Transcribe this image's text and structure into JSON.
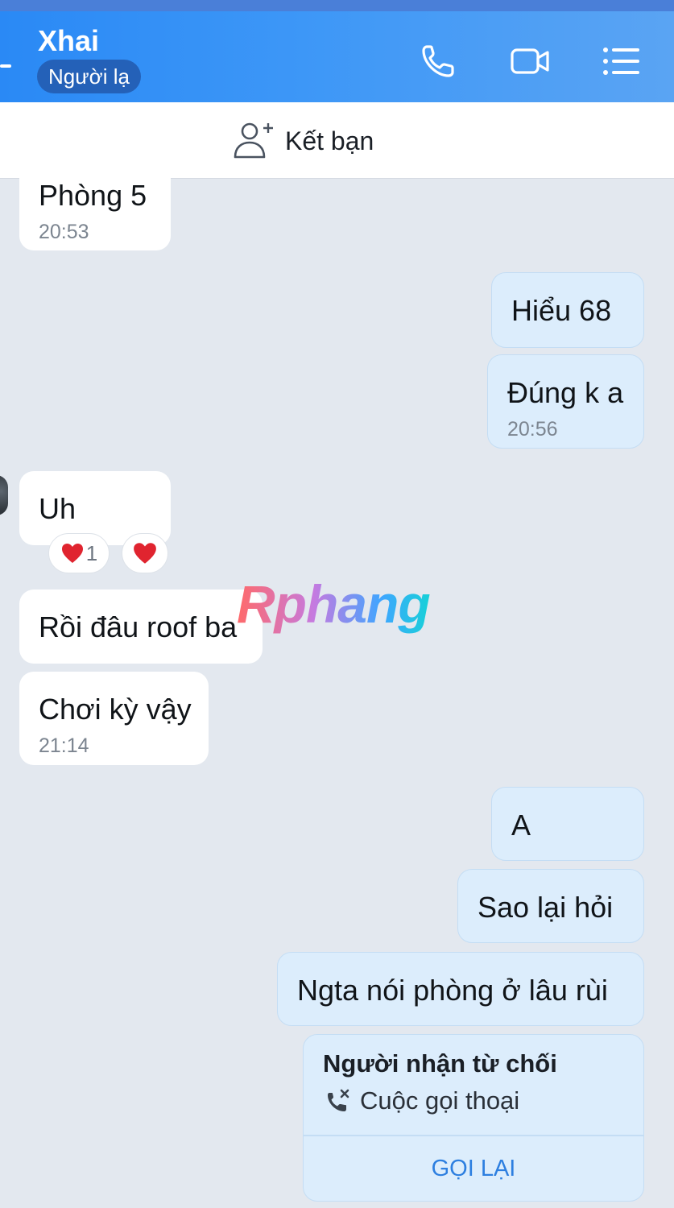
{
  "header": {
    "contact_name": "Xhai",
    "badge": "Người lạ",
    "icons": [
      "back-icon",
      "phone-icon",
      "video-camera-icon",
      "menu-list-icon"
    ]
  },
  "add_friend": {
    "label": "Kết bạn",
    "icon": "add-person-icon"
  },
  "messages": [
    {
      "direction": "in",
      "text": "Phòng 5",
      "time": "20:53"
    },
    {
      "direction": "out",
      "text": "Hiểu 68"
    },
    {
      "direction": "out",
      "text": "Đúng k a",
      "time": "20:56"
    },
    {
      "direction": "in",
      "text": "Uh"
    },
    {
      "direction": "in",
      "text": "Rồi đâu roof ba"
    },
    {
      "direction": "in",
      "text": "Chơi kỳ vậy",
      "time": "21:14"
    },
    {
      "direction": "out",
      "text": "A"
    },
    {
      "direction": "out",
      "text": "Sao lại hỏi"
    },
    {
      "direction": "out",
      "text": "Ngta nói phòng ở lâu rùi"
    }
  ],
  "reactions": {
    "heart_count": "1",
    "icon": "heart-icon"
  },
  "call_card": {
    "title": "Người nhận từ chối",
    "subtitle": "Cuộc gọi thoại",
    "action": "GỌI LẠI",
    "icon": "missed-call-icon"
  },
  "watermark": "Rphang",
  "colors": {
    "header_start": "#2a89f5",
    "header_end": "#5aa4f3",
    "outgoing_bubble": "#dcedfc",
    "incoming_bubble": "#ffffff",
    "background": "#e3e8ef",
    "action_blue": "#2d7fe0"
  }
}
